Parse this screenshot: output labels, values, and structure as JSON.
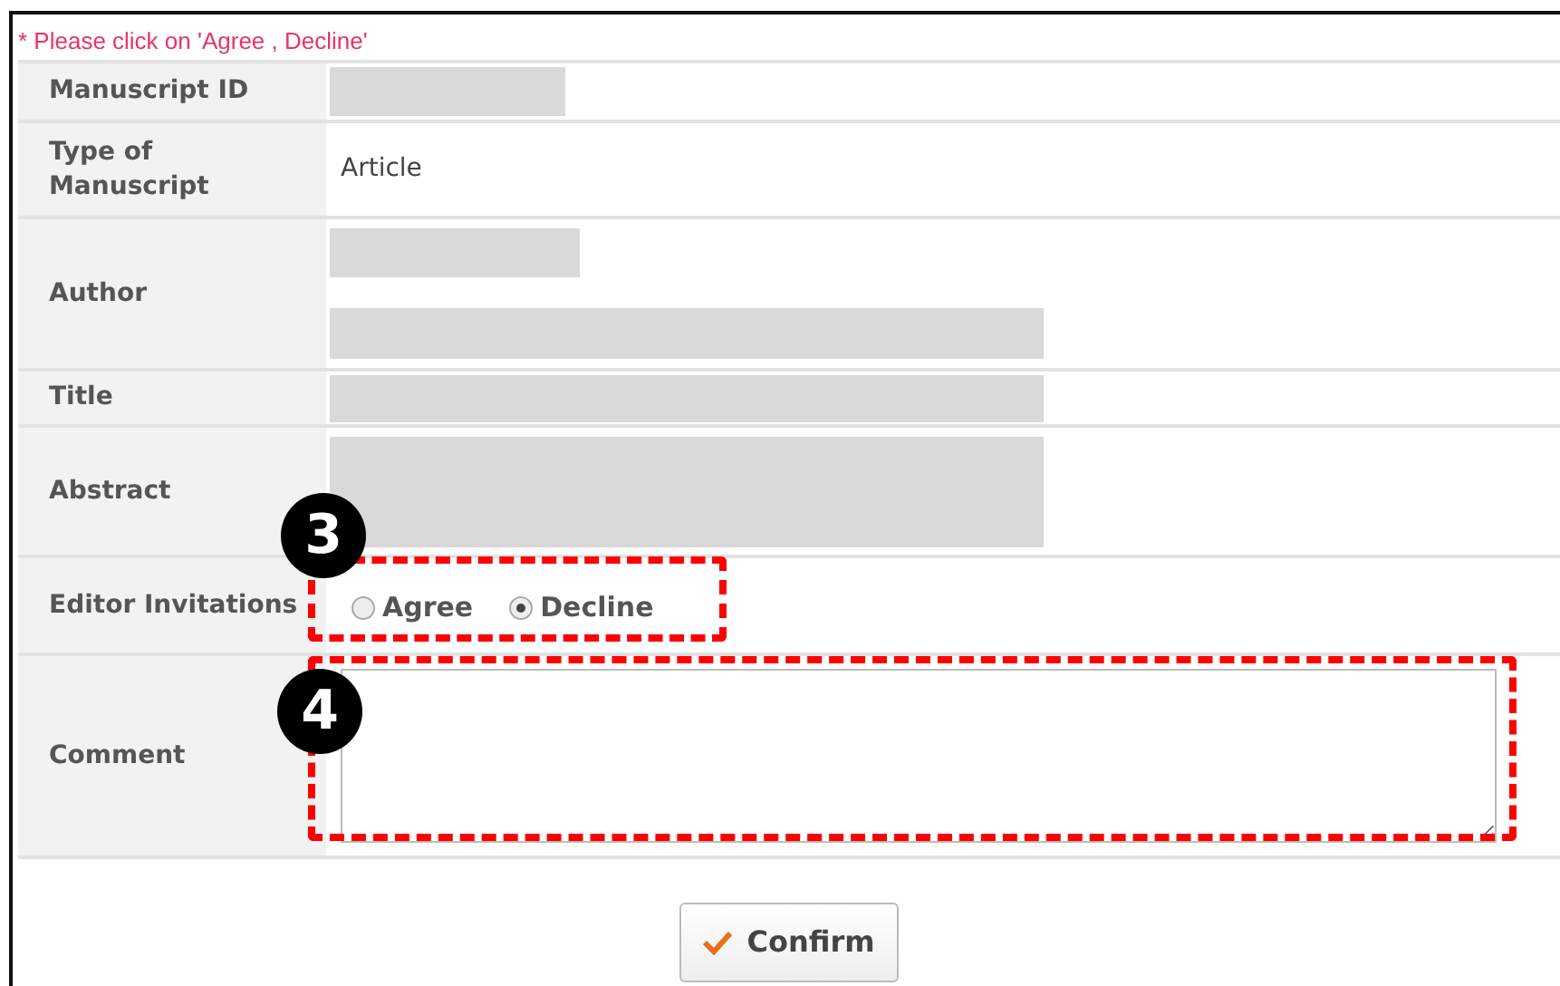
{
  "notice": "* Please click on 'Agree , Decline'",
  "rows": [
    {
      "label": "Manuscript ID",
      "kind": "redacted"
    },
    {
      "label": "Type of Manuscript",
      "kind": "text",
      "value": "Article"
    },
    {
      "label": "Author",
      "kind": "redacted_pair"
    },
    {
      "label": "Title",
      "kind": "redacted"
    },
    {
      "label": "Abstract",
      "kind": "redacted_tall"
    },
    {
      "label": "Editor Invitations",
      "kind": "radio",
      "options": [
        {
          "label": "Agree",
          "selected": false
        },
        {
          "label": "Decline",
          "selected": true
        }
      ]
    },
    {
      "label": "Comment",
      "kind": "textarea"
    }
  ],
  "annotations": [
    {
      "number": "3"
    },
    {
      "number": "4"
    }
  ],
  "confirm_button": "Confirm"
}
